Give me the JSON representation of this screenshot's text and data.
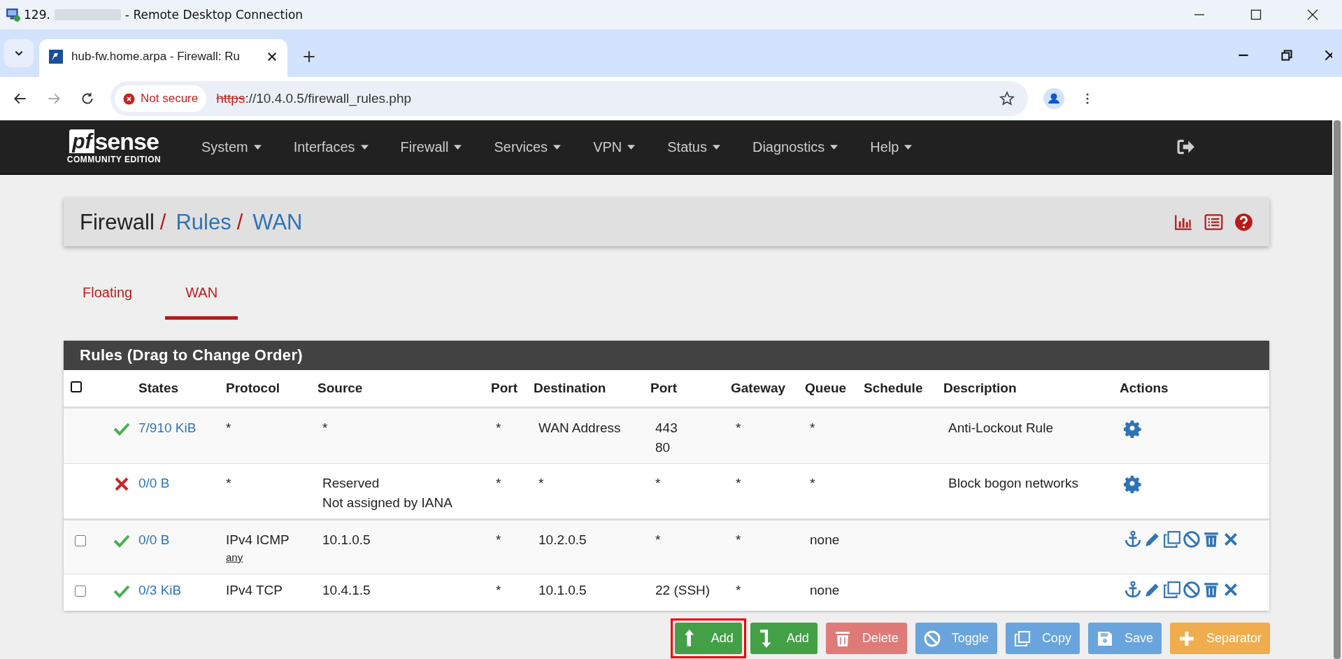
{
  "window": {
    "title_prefix": "129.",
    "title_suffix": "- Remote Desktop Connection"
  },
  "browser": {
    "tab_title": "hub-fw.home.arpa - Firewall: Ru",
    "security": "Not secure",
    "url_scheme": "https",
    "url_rest": "://10.4.0.5/firewall_rules.php"
  },
  "navbar": {
    "logo_mark": "pf",
    "logo_word": "sense",
    "logo_edition": "COMMUNITY EDITION",
    "items": [
      "System",
      "Interfaces",
      "Firewall",
      "Services",
      "VPN",
      "Status",
      "Diagnostics",
      "Help"
    ]
  },
  "breadcrumb": {
    "separator": "/",
    "items": [
      {
        "label": "Firewall",
        "link": false
      },
      {
        "label": "Rules",
        "link": true
      },
      {
        "label": "WAN",
        "link": true
      }
    ]
  },
  "tabs": [
    {
      "label": "Floating",
      "selected": false
    },
    {
      "label": "WAN",
      "selected": true
    }
  ],
  "rules": {
    "title": "Rules (Drag to Change Order)",
    "select_all_checked": false,
    "columns": [
      "States",
      "Protocol",
      "Source",
      "Port",
      "Destination",
      "Port",
      "Gateway",
      "Queue",
      "Schedule",
      "Description",
      "Actions"
    ],
    "rows": [
      {
        "kind": "system",
        "blocked": false,
        "states": "7/910 KiB",
        "protocol": "*",
        "source": [
          "*"
        ],
        "source_port": "*",
        "destination": "WAN Address",
        "destination_port": [
          "443",
          "80"
        ],
        "gateway": "*",
        "queue": "*",
        "description": "Anti-Lockout Rule"
      },
      {
        "kind": "system",
        "blocked": true,
        "states": "0/0 B",
        "protocol": "*",
        "source": [
          "Reserved",
          "Not assigned by IANA"
        ],
        "source_port": "*",
        "destination": "*",
        "destination_port": [
          "*"
        ],
        "gateway": "*",
        "queue": "*",
        "description": "Block bogon networks"
      },
      {
        "kind": "user",
        "checked": false,
        "blocked": false,
        "states": "0/0 B",
        "protocol": "IPv4 ICMP",
        "protocol_detail": "any",
        "source": [
          "10.1.0.5"
        ],
        "source_port": "*",
        "destination": "10.2.0.5",
        "destination_port": [
          "*"
        ],
        "gateway": "*",
        "queue": "none"
      },
      {
        "kind": "user",
        "checked": false,
        "blocked": false,
        "states": "0/3 KiB",
        "protocol": "IPv4 TCP",
        "source": [
          "10.4.1.5"
        ],
        "source_port": "*",
        "destination": "10.1.0.5",
        "destination_port": [
          "22 (SSH)"
        ],
        "gateway": "*",
        "queue": "none"
      }
    ]
  },
  "buttons": [
    {
      "kind": "add-top",
      "label": "Add",
      "disabled": false,
      "highlighted": true
    },
    {
      "kind": "add-bottom",
      "label": "Add",
      "disabled": false,
      "highlighted": false
    },
    {
      "kind": "delete",
      "label": "Delete",
      "disabled": true,
      "highlighted": false
    },
    {
      "kind": "toggle",
      "label": "Toggle",
      "disabled": true,
      "highlighted": false
    },
    {
      "kind": "copy",
      "label": "Copy",
      "disabled": true,
      "highlighted": false
    },
    {
      "kind": "save",
      "label": "Save",
      "disabled": true,
      "highlighted": false
    },
    {
      "kind": "separator",
      "label": "Separator",
      "disabled": false,
      "highlighted": false
    }
  ]
}
